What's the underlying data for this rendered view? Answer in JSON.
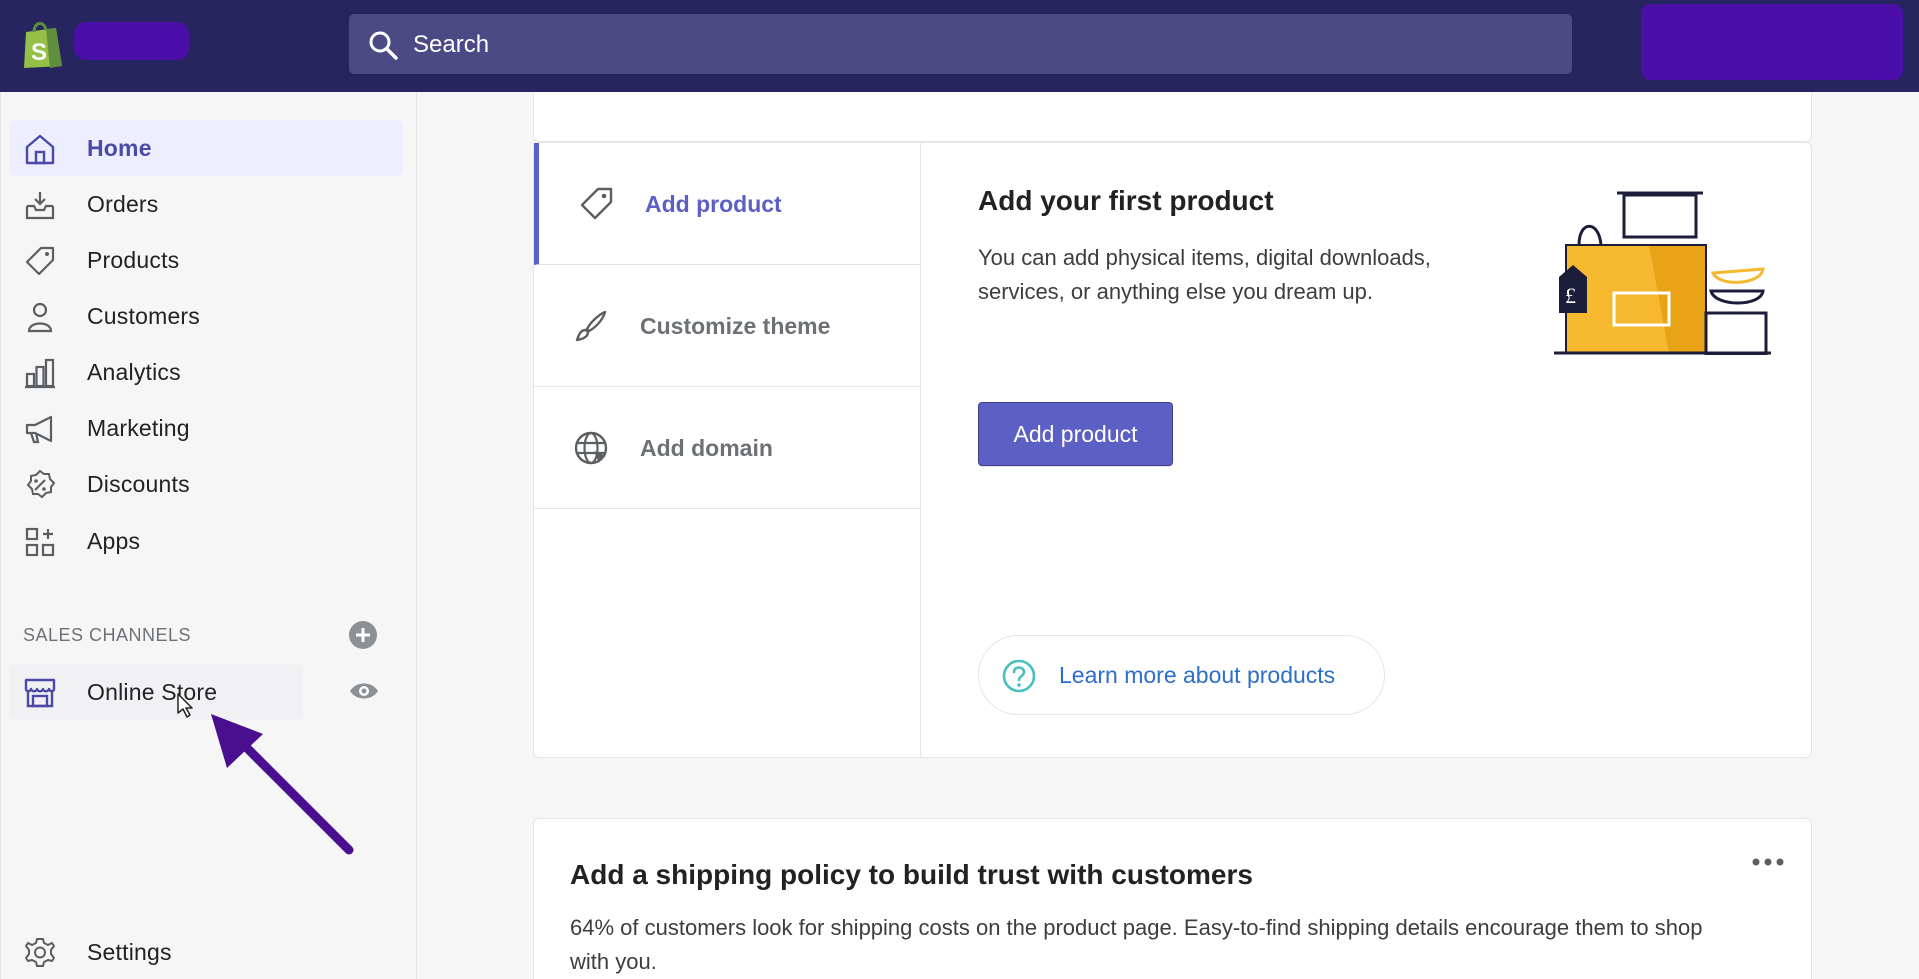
{
  "topbar": {
    "search_placeholder": "Search"
  },
  "sidebar": {
    "items": [
      {
        "label": "Home",
        "icon": "home-icon",
        "active": true
      },
      {
        "label": "Orders",
        "icon": "inbox-icon"
      },
      {
        "label": "Products",
        "icon": "tag-icon"
      },
      {
        "label": "Customers",
        "icon": "person-icon"
      },
      {
        "label": "Analytics",
        "icon": "bar-chart-icon"
      },
      {
        "label": "Marketing",
        "icon": "megaphone-icon"
      },
      {
        "label": "Discounts",
        "icon": "discount-icon"
      },
      {
        "label": "Apps",
        "icon": "apps-icon"
      }
    ],
    "sales_channels_title": "SALES CHANNELS",
    "online_store_label": "Online Store",
    "settings_label": "Settings"
  },
  "setup": {
    "tabs": [
      {
        "label": "Add product",
        "icon": "tag-icon",
        "active": true
      },
      {
        "label": "Customize theme",
        "icon": "brush-icon"
      },
      {
        "label": "Add domain",
        "icon": "globe-icon"
      }
    ],
    "title": "Add your first product",
    "description": "You can add physical items, digital downloads, services, or anything else you dream up.",
    "button_label": "Add product",
    "learn_more_label": "Learn more about products"
  },
  "shipping": {
    "title": "Add a shipping policy to build trust with customers",
    "description": "64% of customers look for shipping costs on the product page. Easy-to-find shipping details encourage them to shop with you."
  },
  "colors": {
    "topbar": "#27255f",
    "accent": "#5c5fc4",
    "highlight": "#4a0fa8"
  }
}
